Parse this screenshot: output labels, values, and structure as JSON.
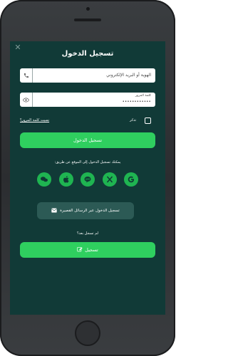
{
  "title": "تسجيل الدخول",
  "username_field": {
    "placeholder": "الهوية أو البريد الإلكتروني",
    "icon": "phone-icon"
  },
  "password_field": {
    "label": "كلمة المرور",
    "value": "••••••••••••",
    "icon": "eye-icon"
  },
  "remember_label": "تذكر",
  "remember_checked": false,
  "forgot_link": "نسيت كلمة المرور؟",
  "login_button": "تسجيل الدخول",
  "social_caption": "يمكنك تسجيل الدخول إلى الموقع عن طريق:",
  "social_buttons": [
    "google-icon",
    "x-icon",
    "line-icon",
    "apple-icon",
    "wechat-icon"
  ],
  "sms_button": "تسجيل الدخول عبر الرسائل القصيرة",
  "no_account_text": "لم تسجل بعد؟",
  "register_button": "تسجيل",
  "colors": {
    "screen_bg": "#113a37",
    "accent_green": "#2fcf5f",
    "social_green": "#1fb451",
    "sms_button_bg": "#2c5a55"
  }
}
